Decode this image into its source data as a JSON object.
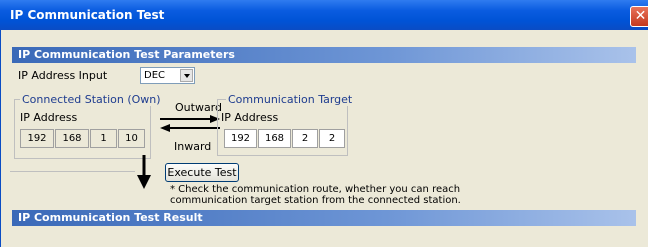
{
  "window": {
    "title": "IP Communication Test",
    "close_glyph": "✕"
  },
  "params": {
    "header": "IP Communication Test Parameters",
    "ip_input_label": "IP Address Input",
    "ip_input_value": "DEC"
  },
  "connected": {
    "group_title": "Connected Station (Own)",
    "ip_label": "IP Address",
    "ip": [
      "192",
      "168",
      "1",
      "10"
    ]
  },
  "arrows": {
    "outward": "Outward",
    "inward": "Inward"
  },
  "target": {
    "group_title": "Communication Target",
    "ip_label": "IP Address",
    "ip": [
      "192",
      "168",
      "2",
      "2"
    ]
  },
  "execute_button": "Execute Test",
  "note_line1": "* Check the communication route, whether you can reach",
  "note_line2": "communication target station from the connected station.",
  "result": {
    "header": "IP Communication Test Result"
  }
}
